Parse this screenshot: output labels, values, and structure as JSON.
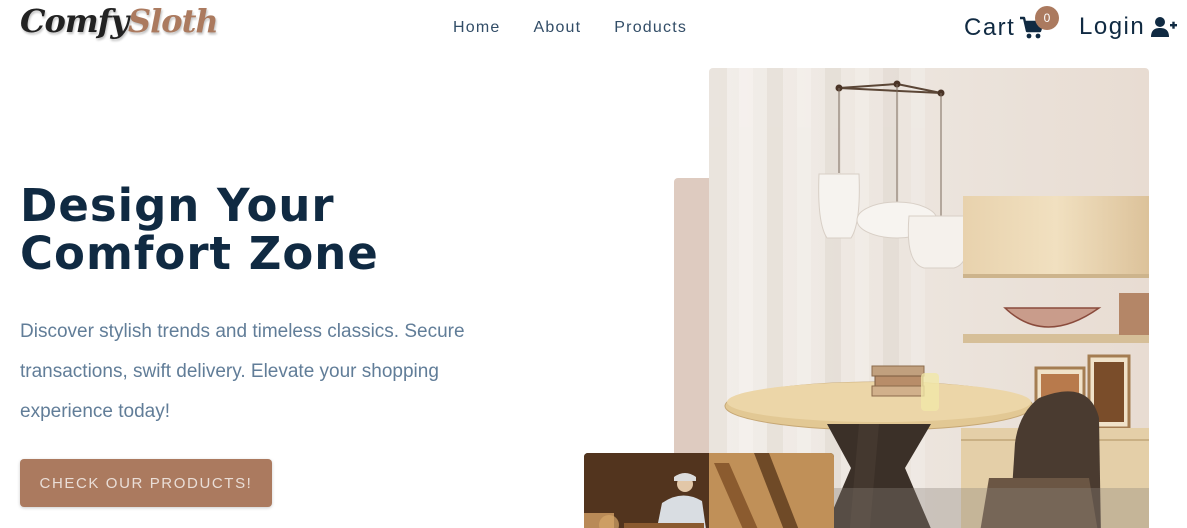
{
  "brand": {
    "part1": "Comfy",
    "part2": "Sloth"
  },
  "nav": {
    "links": [
      {
        "label": "Home"
      },
      {
        "label": "About"
      },
      {
        "label": "Products"
      }
    ],
    "cart_label": "Cart",
    "cart_count": "0",
    "login_label": "Login"
  },
  "hero": {
    "title_line1": "Design Your",
    "title_line2": "Comfort Zone",
    "description": "Discover stylish trends and timeless classics. Secure transactions, swift delivery. Elevate your shopping experience today!",
    "cta_label": "CHECK OUR PRODUCTS!"
  },
  "icons": {
    "cart": "shopping-cart-icon",
    "login": "user-plus-icon"
  },
  "colors": {
    "primary": "#ab7a5f",
    "heading": "#102a42",
    "text": "#617d98",
    "accent_block": "#decbc0"
  }
}
